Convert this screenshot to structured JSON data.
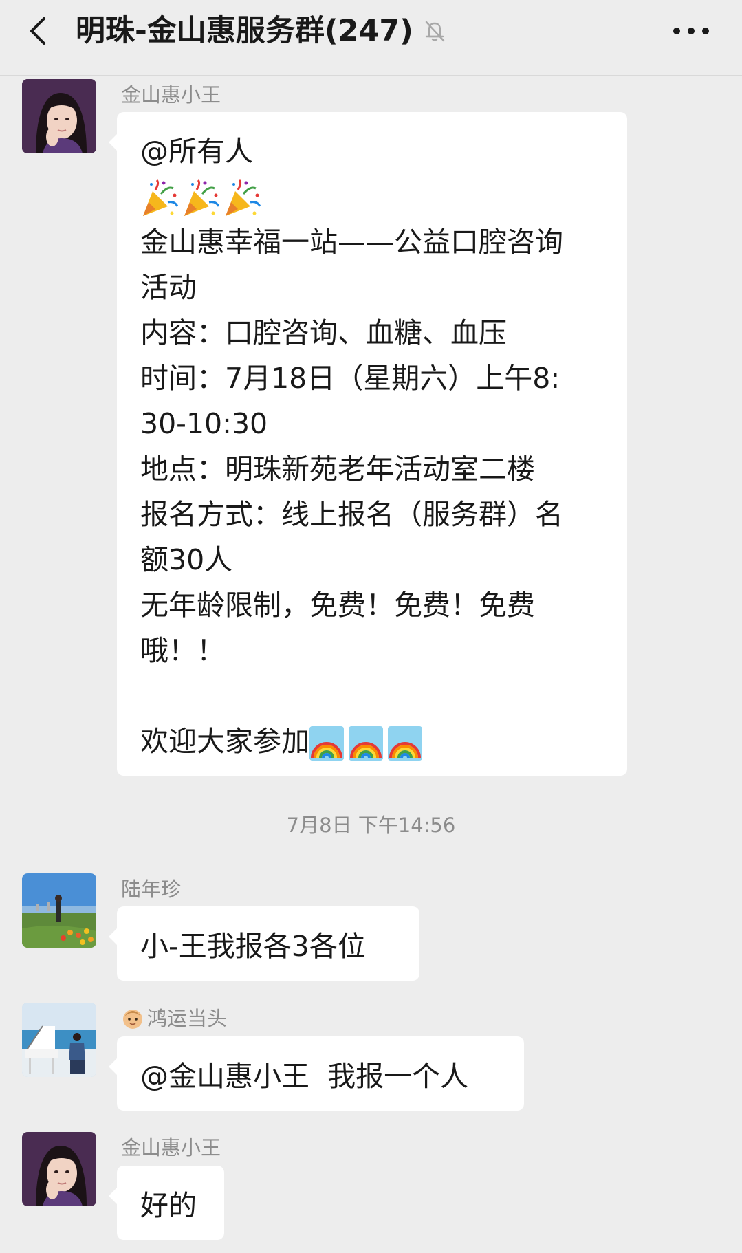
{
  "header": {
    "back_icon": "chevron-left-icon",
    "title": "明珠-金山惠服务群(247)",
    "mute_icon": "bell-off-icon",
    "more_icon": "more-dots-icon"
  },
  "messages": [
    {
      "sender": "金山惠小王",
      "lines": [
        "@所有人",
        "",
        "金山惠幸福一站——公益口腔咨询",
        "活动",
        "内容：口腔咨询、血糖、血压",
        "时间：7月18日（星期六）上午8:",
        "30-10:30",
        "地点：明珠新苑老年活动室二楼",
        "报名方式：线上报名（服务群）名",
        "额30人",
        "无年龄限制，免费！免费！免费",
        "哦！！",
        "",
        "欢迎大家参加"
      ],
      "emoji_party": "party-popper-emoji",
      "emoji_rainbow": "rainbow-emoji"
    },
    {
      "sender": "陆年珍",
      "text": "小-王我报各3各位"
    },
    {
      "sender": "鸿运当头",
      "sender_emoji": "baby-face-emoji",
      "text": "@金山惠小王  我报一个人"
    },
    {
      "sender": "金山惠小王",
      "text": "好的"
    }
  ],
  "timestamp": "7月8日 下午14:56",
  "colors": {
    "background": "#ededed",
    "bubble": "#ffffff",
    "text": "#191919",
    "meta_text": "#8c8c8c"
  }
}
